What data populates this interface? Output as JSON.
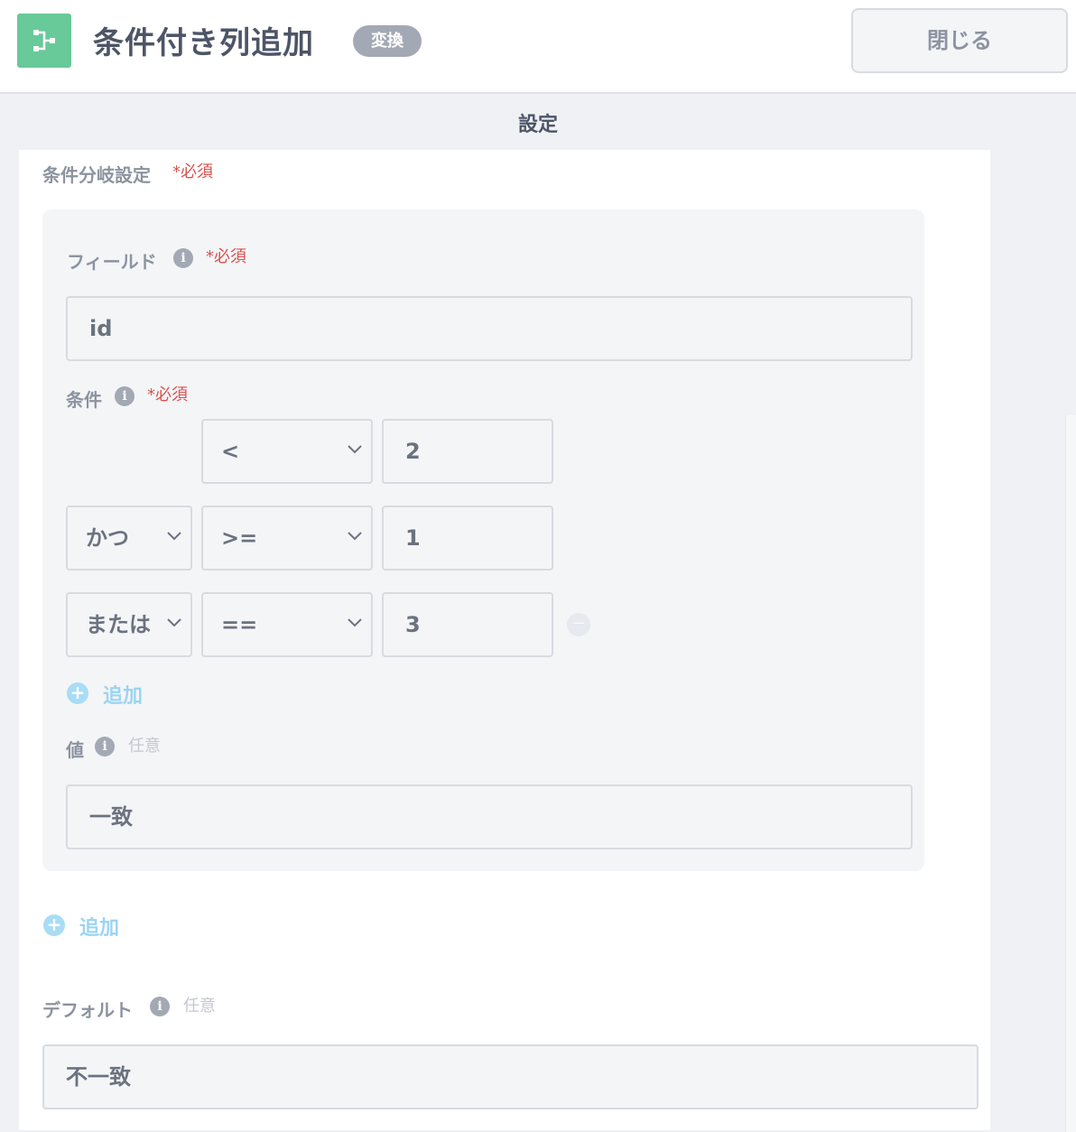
{
  "header": {
    "title": "条件付き列追加",
    "badge": "変換",
    "close_label": "閉じる"
  },
  "section_title": "設定",
  "conditional": {
    "label": "条件分岐設定",
    "required": "*必須",
    "field": {
      "label": "フィールド",
      "required": "*必須",
      "value": "id"
    },
    "condition": {
      "label": "条件",
      "required": "*必須",
      "rows": [
        {
          "connector": "",
          "operator": "<",
          "value": "2"
        },
        {
          "connector": "かつ",
          "operator": ">=",
          "value": "1"
        },
        {
          "connector": "または",
          "operator": "==",
          "value": "3"
        }
      ],
      "add_label": "追加"
    },
    "value": {
      "label": "値",
      "optional": "任意",
      "value": "一致"
    },
    "add_label": "追加"
  },
  "default": {
    "label": "デフォルト",
    "optional": "任意",
    "value": "不一致"
  },
  "icons": {
    "app": "flow-branch-icon",
    "info": "info-icon",
    "add": "plus-circle-icon",
    "remove": "minus-circle-icon",
    "dropdown": "chevron-down-icon"
  },
  "colors": {
    "app_icon": "#68c999",
    "required": "#d9534f",
    "add_link": "#9cd4f2",
    "badge": "#a3a9b4"
  }
}
